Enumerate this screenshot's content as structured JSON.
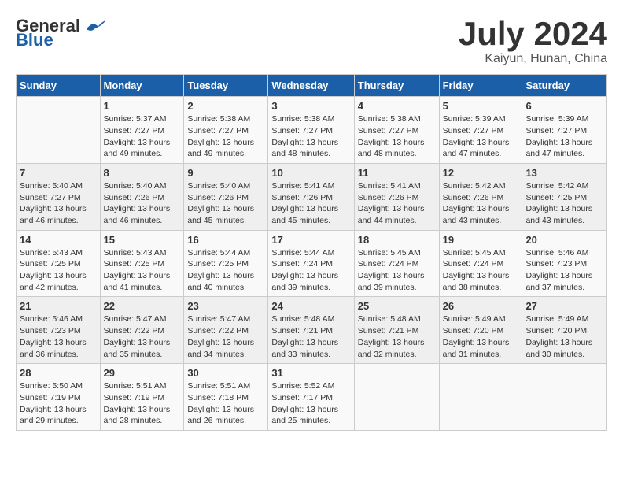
{
  "logo": {
    "general": "General",
    "blue": "Blue"
  },
  "title": "July 2024",
  "location": "Kaiyun, Hunan, China",
  "days_of_week": [
    "Sunday",
    "Monday",
    "Tuesday",
    "Wednesday",
    "Thursday",
    "Friday",
    "Saturday"
  ],
  "weeks": [
    [
      {
        "day": "",
        "info": ""
      },
      {
        "day": "1",
        "info": "Sunrise: 5:37 AM\nSunset: 7:27 PM\nDaylight: 13 hours\nand 49 minutes."
      },
      {
        "day": "2",
        "info": "Sunrise: 5:38 AM\nSunset: 7:27 PM\nDaylight: 13 hours\nand 49 minutes."
      },
      {
        "day": "3",
        "info": "Sunrise: 5:38 AM\nSunset: 7:27 PM\nDaylight: 13 hours\nand 48 minutes."
      },
      {
        "day": "4",
        "info": "Sunrise: 5:38 AM\nSunset: 7:27 PM\nDaylight: 13 hours\nand 48 minutes."
      },
      {
        "day": "5",
        "info": "Sunrise: 5:39 AM\nSunset: 7:27 PM\nDaylight: 13 hours\nand 47 minutes."
      },
      {
        "day": "6",
        "info": "Sunrise: 5:39 AM\nSunset: 7:27 PM\nDaylight: 13 hours\nand 47 minutes."
      }
    ],
    [
      {
        "day": "7",
        "info": "Sunrise: 5:40 AM\nSunset: 7:27 PM\nDaylight: 13 hours\nand 46 minutes."
      },
      {
        "day": "8",
        "info": "Sunrise: 5:40 AM\nSunset: 7:26 PM\nDaylight: 13 hours\nand 46 minutes."
      },
      {
        "day": "9",
        "info": "Sunrise: 5:40 AM\nSunset: 7:26 PM\nDaylight: 13 hours\nand 45 minutes."
      },
      {
        "day": "10",
        "info": "Sunrise: 5:41 AM\nSunset: 7:26 PM\nDaylight: 13 hours\nand 45 minutes."
      },
      {
        "day": "11",
        "info": "Sunrise: 5:41 AM\nSunset: 7:26 PM\nDaylight: 13 hours\nand 44 minutes."
      },
      {
        "day": "12",
        "info": "Sunrise: 5:42 AM\nSunset: 7:26 PM\nDaylight: 13 hours\nand 43 minutes."
      },
      {
        "day": "13",
        "info": "Sunrise: 5:42 AM\nSunset: 7:25 PM\nDaylight: 13 hours\nand 43 minutes."
      }
    ],
    [
      {
        "day": "14",
        "info": "Sunrise: 5:43 AM\nSunset: 7:25 PM\nDaylight: 13 hours\nand 42 minutes."
      },
      {
        "day": "15",
        "info": "Sunrise: 5:43 AM\nSunset: 7:25 PM\nDaylight: 13 hours\nand 41 minutes."
      },
      {
        "day": "16",
        "info": "Sunrise: 5:44 AM\nSunset: 7:25 PM\nDaylight: 13 hours\nand 40 minutes."
      },
      {
        "day": "17",
        "info": "Sunrise: 5:44 AM\nSunset: 7:24 PM\nDaylight: 13 hours\nand 39 minutes."
      },
      {
        "day": "18",
        "info": "Sunrise: 5:45 AM\nSunset: 7:24 PM\nDaylight: 13 hours\nand 39 minutes."
      },
      {
        "day": "19",
        "info": "Sunrise: 5:45 AM\nSunset: 7:24 PM\nDaylight: 13 hours\nand 38 minutes."
      },
      {
        "day": "20",
        "info": "Sunrise: 5:46 AM\nSunset: 7:23 PM\nDaylight: 13 hours\nand 37 minutes."
      }
    ],
    [
      {
        "day": "21",
        "info": "Sunrise: 5:46 AM\nSunset: 7:23 PM\nDaylight: 13 hours\nand 36 minutes."
      },
      {
        "day": "22",
        "info": "Sunrise: 5:47 AM\nSunset: 7:22 PM\nDaylight: 13 hours\nand 35 minutes."
      },
      {
        "day": "23",
        "info": "Sunrise: 5:47 AM\nSunset: 7:22 PM\nDaylight: 13 hours\nand 34 minutes."
      },
      {
        "day": "24",
        "info": "Sunrise: 5:48 AM\nSunset: 7:21 PM\nDaylight: 13 hours\nand 33 minutes."
      },
      {
        "day": "25",
        "info": "Sunrise: 5:48 AM\nSunset: 7:21 PM\nDaylight: 13 hours\nand 32 minutes."
      },
      {
        "day": "26",
        "info": "Sunrise: 5:49 AM\nSunset: 7:20 PM\nDaylight: 13 hours\nand 31 minutes."
      },
      {
        "day": "27",
        "info": "Sunrise: 5:49 AM\nSunset: 7:20 PM\nDaylight: 13 hours\nand 30 minutes."
      }
    ],
    [
      {
        "day": "28",
        "info": "Sunrise: 5:50 AM\nSunset: 7:19 PM\nDaylight: 13 hours\nand 29 minutes."
      },
      {
        "day": "29",
        "info": "Sunrise: 5:51 AM\nSunset: 7:19 PM\nDaylight: 13 hours\nand 28 minutes."
      },
      {
        "day": "30",
        "info": "Sunrise: 5:51 AM\nSunset: 7:18 PM\nDaylight: 13 hours\nand 26 minutes."
      },
      {
        "day": "31",
        "info": "Sunrise: 5:52 AM\nSunset: 7:17 PM\nDaylight: 13 hours\nand 25 minutes."
      },
      {
        "day": "",
        "info": ""
      },
      {
        "day": "",
        "info": ""
      },
      {
        "day": "",
        "info": ""
      }
    ]
  ]
}
